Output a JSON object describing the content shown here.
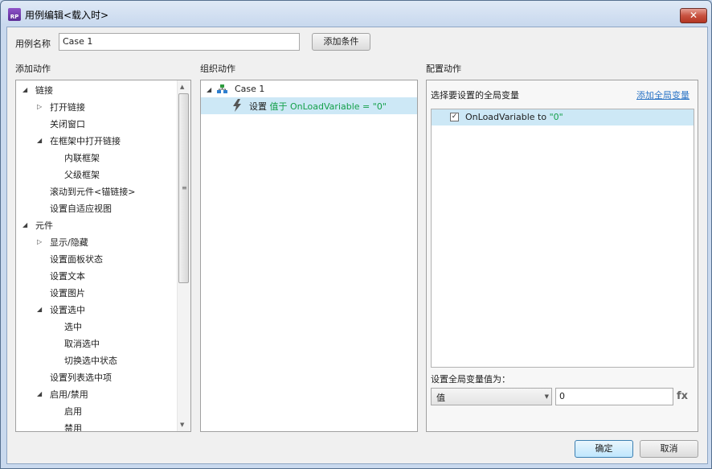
{
  "window": {
    "title": "用例编辑<载入时>",
    "icon_text": "RP",
    "close_symbol": "✕"
  },
  "case_name": {
    "label": "用例名称",
    "value": "Case 1",
    "add_condition_label": "添加条件"
  },
  "sections": {
    "add_actions": "添加动作",
    "organize_actions": "组织动作",
    "configure_actions": "配置动作"
  },
  "actions_tree": [
    {
      "label": "链接",
      "expander": "◢"
    },
    {
      "label": "打开链接",
      "expander": "▷"
    },
    {
      "label": "关闭窗口",
      "expander": ""
    },
    {
      "label": "在框架中打开链接",
      "expander": "◢"
    },
    {
      "label": "内联框架",
      "expander": ""
    },
    {
      "label": "父级框架",
      "expander": ""
    },
    {
      "label": "滚动到元件<锚链接>",
      "expander": ""
    },
    {
      "label": "设置自适应视图",
      "expander": ""
    },
    {
      "label": "元件",
      "expander": "◢"
    },
    {
      "label": "显示/隐藏",
      "expander": "▷"
    },
    {
      "label": "设置面板状态",
      "expander": ""
    },
    {
      "label": "设置文本",
      "expander": ""
    },
    {
      "label": "设置图片",
      "expander": ""
    },
    {
      "label": "设置选中",
      "expander": "◢"
    },
    {
      "label": "选中",
      "expander": ""
    },
    {
      "label": "取消选中",
      "expander": ""
    },
    {
      "label": "切换选中状态",
      "expander": ""
    },
    {
      "label": "设置列表选中项",
      "expander": ""
    },
    {
      "label": "启用/禁用",
      "expander": "◢"
    },
    {
      "label": "启用",
      "expander": ""
    },
    {
      "label": "禁用",
      "expander": ""
    }
  ],
  "organize": {
    "case_expander": "◢",
    "case_label": "Case 1",
    "action_prefix": "设置",
    "action_detail": "值于 OnLoadVariable = \"0\""
  },
  "configure": {
    "choose_label": "选择要设置的全局变量",
    "add_global_link": "添加全局变量",
    "variable_item": {
      "name": "OnLoadVariable to",
      "value": "\"0\"",
      "checked": true,
      "check_mark": "✓"
    },
    "set_value_label": "设置全局变量值为：",
    "type_select": "值",
    "value_input": "0",
    "fx_label": "fx"
  },
  "buttons": {
    "ok": "确定",
    "cancel": "取消"
  },
  "colors": {
    "accent_green": "#15a04a",
    "selection": "#cde8f6",
    "link": "#2c75c6"
  }
}
